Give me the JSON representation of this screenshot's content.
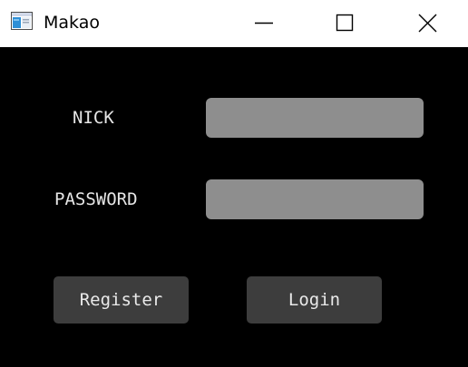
{
  "window": {
    "title": "Makao",
    "controls": [
      "minimize-icon",
      "maximize-icon",
      "close-icon"
    ]
  },
  "form": {
    "nick_label": "NICK",
    "nick_value": "",
    "password_label": "PASSWORD",
    "password_value": ""
  },
  "buttons": {
    "register_label": "Register",
    "login_label": "Login"
  },
  "colors": {
    "background": "#000000",
    "field": "#8e8e8e",
    "button": "#3d3d3d",
    "text": "#e6e6e6"
  }
}
